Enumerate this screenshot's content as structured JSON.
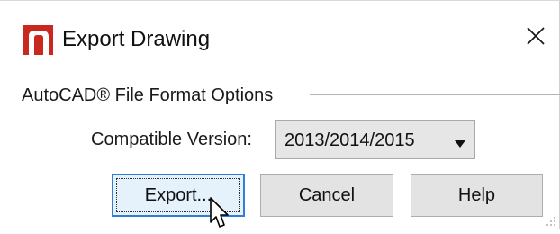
{
  "window": {
    "title": "Export Drawing",
    "app_icon": "chief-architect-logo-icon",
    "close_icon": "close-icon"
  },
  "group": {
    "label": "AutoCAD® File Format Options"
  },
  "compatible_version": {
    "label": "Compatible Version:",
    "selected": "2013/2014/2015",
    "arrow_icon": "dropdown-arrow-icon"
  },
  "buttons": {
    "export": "Export...",
    "cancel": "Cancel",
    "help": "Help"
  },
  "colors": {
    "accent_focus": "#2f7fd6",
    "logo_red": "#c8281e"
  }
}
